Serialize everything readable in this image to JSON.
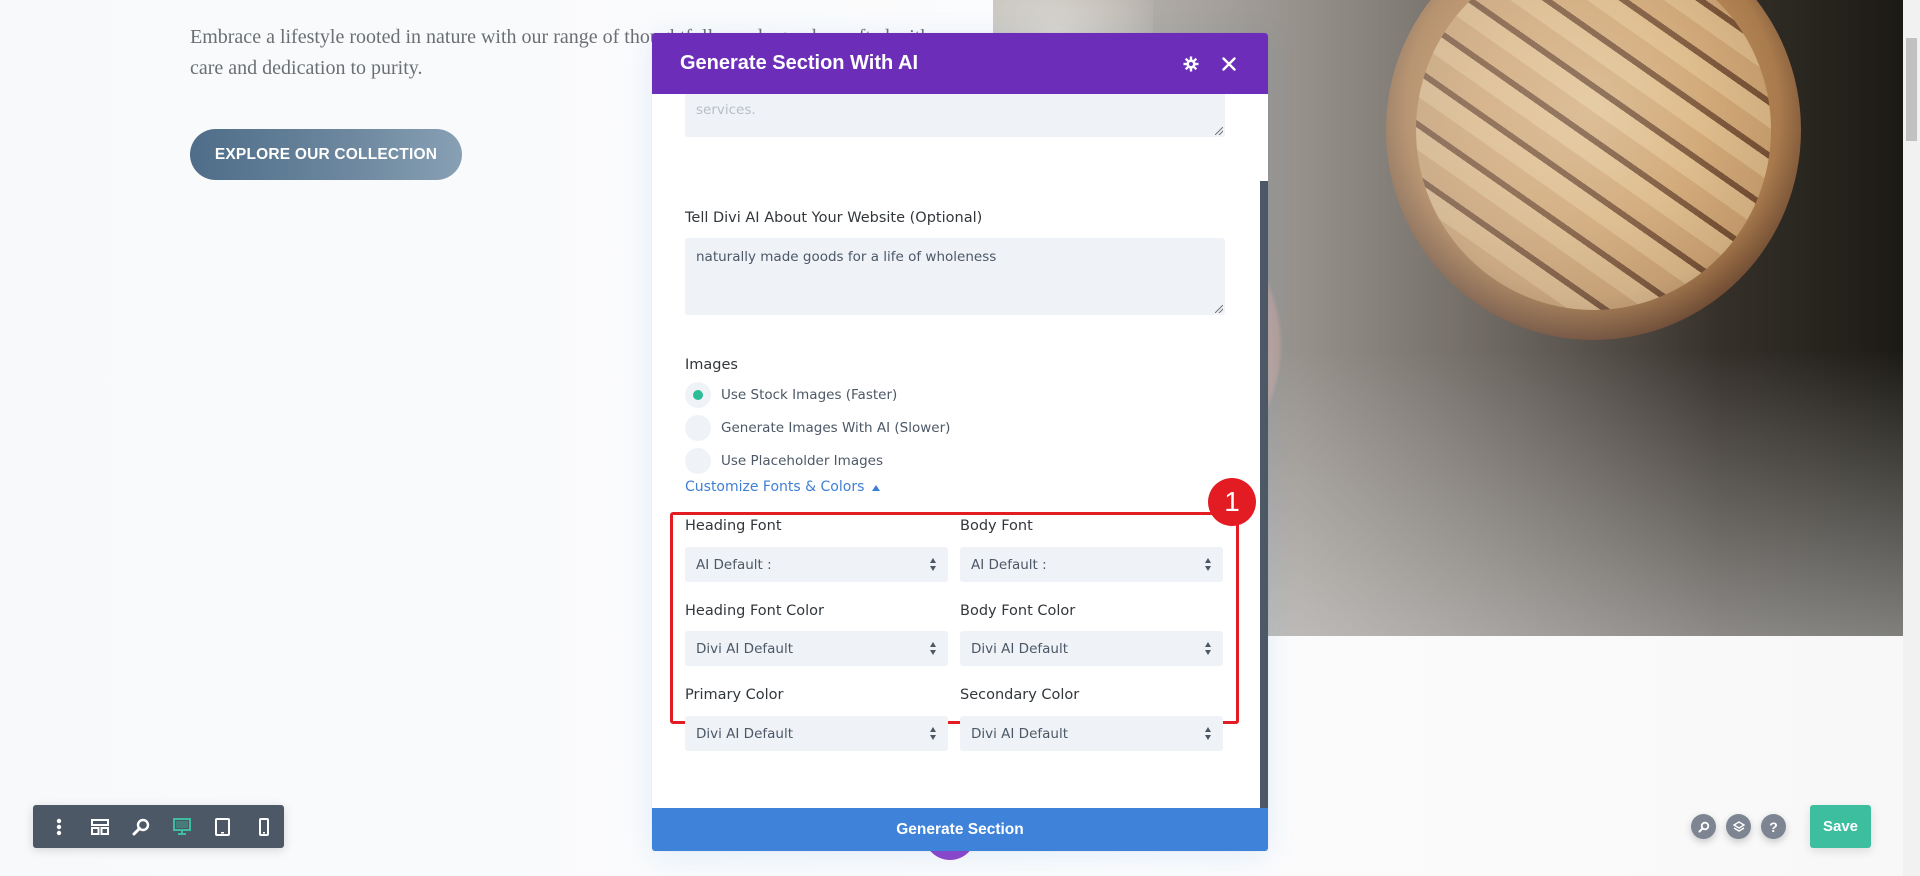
{
  "page": {
    "hero_text": "Embrace a lifestyle rooted in nature with our range of thoughtfully made goods, crafted with care and dedication to purity.",
    "explore_button": "EXPLORE OUR COLLECTION"
  },
  "modal": {
    "title": "Generate Section With AI",
    "settings_icon": "gear-icon",
    "close_icon": "close-icon",
    "previous_textarea_tail": "services.",
    "website_label": "Tell Divi AI About Your Website (Optional)",
    "website_value": "naturally made goods for a life of wholeness",
    "images_label": "Images",
    "image_options": [
      {
        "label": "Use Stock Images (Faster)",
        "selected": true
      },
      {
        "label": "Generate Images With AI (Slower)",
        "selected": false
      },
      {
        "label": "Use Placeholder Images",
        "selected": false
      }
    ],
    "customize_link": "Customize Fonts & Colors",
    "fields": {
      "heading_font": {
        "label": "Heading Font",
        "value": "AI Default :"
      },
      "body_font": {
        "label": "Body Font",
        "value": "AI Default :"
      },
      "heading_font_color": {
        "label": "Heading Font Color",
        "value": "Divi AI Default"
      },
      "body_font_color": {
        "label": "Body Font Color",
        "value": "Divi AI Default"
      },
      "primary_color": {
        "label": "Primary Color",
        "value": "Divi AI Default"
      },
      "secondary_color": {
        "label": "Secondary Color",
        "value": "Divi AI Default"
      }
    },
    "generate_button": "Generate Section"
  },
  "annotation": {
    "badge_number": "1",
    "color": "#e31b23"
  },
  "toolbar": {
    "items": [
      "more-options-icon",
      "wireframe-icon",
      "zoom-icon",
      "desktop-view-icon",
      "tablet-view-icon",
      "phone-view-icon"
    ],
    "active": "desktop-view-icon"
  },
  "right_controls": {
    "icons": [
      "search-icon",
      "layers-icon",
      "help-icon"
    ],
    "save_label": "Save"
  },
  "colors": {
    "modal_header": "#6c2eb9",
    "generate_button": "#3e82d9",
    "save_button": "#3dbf9f",
    "radio_selected": "#2cbd96",
    "link": "#3e7fd6"
  }
}
